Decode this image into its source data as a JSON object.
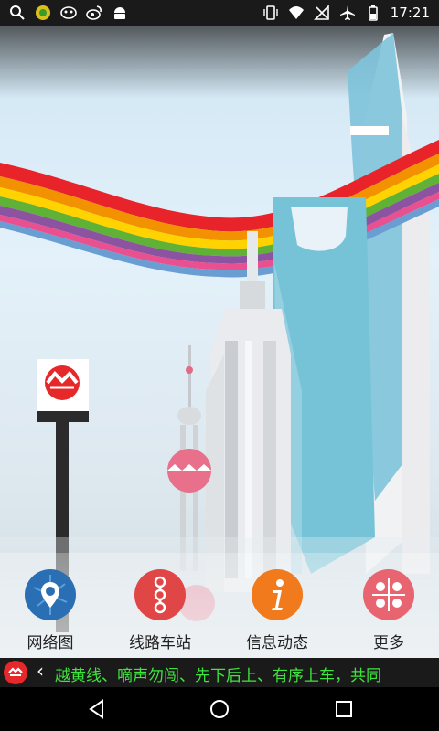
{
  "status_bar": {
    "time": "17:21",
    "left_icons": [
      "search-icon",
      "game-icon",
      "mask-icon",
      "weibo-icon",
      "android-icon"
    ],
    "right_icons": [
      "vibrate-icon",
      "wifi-icon",
      "no-sim-icon",
      "airplane-icon",
      "battery-icon"
    ]
  },
  "menu": {
    "items": [
      {
        "label": "网络图",
        "icon": "network-map-icon",
        "color": "#2a6fb4"
      },
      {
        "label": "线路车站",
        "icon": "line-stations-icon",
        "color": "#e04646"
      },
      {
        "label": "信息动态",
        "icon": "info-icon",
        "color": "#f07a1c"
      },
      {
        "label": "更多",
        "icon": "more-icon",
        "color": "#e86470"
      }
    ]
  },
  "ticker": {
    "text": "越黄线、嘀声勿闯、先下后上、有序上车，共同"
  },
  "colors": {
    "brand_red": "#e6282b",
    "ticker_green": "#3ee63e",
    "tower_blue": "#7ec3dc"
  }
}
